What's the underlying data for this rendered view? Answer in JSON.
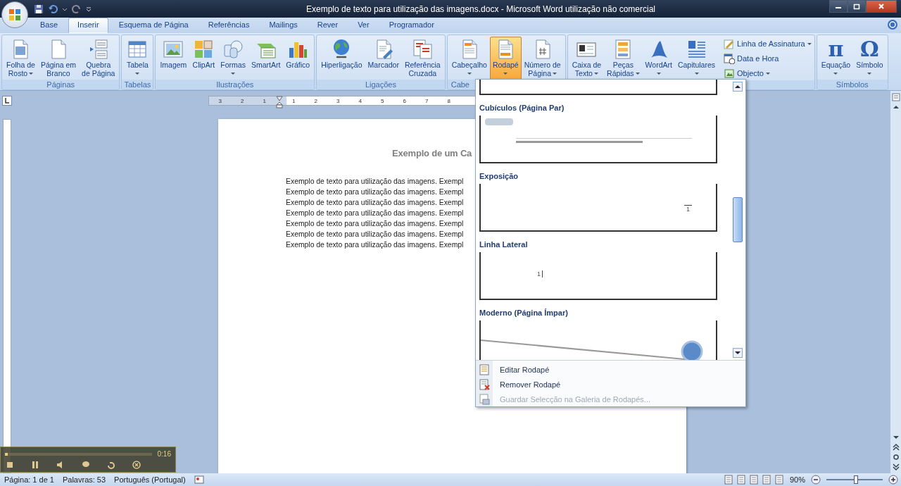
{
  "title_bar": {
    "title": "Exemplo de texto para utilização das imagens.docx - Microsoft Word utilização não comercial"
  },
  "tabs": [
    {
      "label": "Base",
      "selected": false
    },
    {
      "label": "Inserir",
      "selected": true
    },
    {
      "label": "Esquema de Página",
      "selected": false
    },
    {
      "label": "Referências",
      "selected": false
    },
    {
      "label": "Mailings",
      "selected": false
    },
    {
      "label": "Rever",
      "selected": false
    },
    {
      "label": "Ver",
      "selected": false
    },
    {
      "label": "Programador",
      "selected": false
    }
  ],
  "ribbon": {
    "groups": [
      {
        "label": "Páginas",
        "buttons": [
          {
            "lines": [
              "Folha de",
              "Rosto"
            ],
            "menu": true,
            "pressed": false
          },
          {
            "lines": [
              "Página em",
              "Branco"
            ],
            "menu": false,
            "pressed": false
          },
          {
            "lines": [
              "Quebra",
              "de Página"
            ],
            "menu": false,
            "pressed": false
          }
        ]
      },
      {
        "label": "Tabelas",
        "buttons": [
          {
            "lines": [
              "Tabela"
            ],
            "menu": true,
            "pressed": false
          }
        ]
      },
      {
        "label": "Ilustrações",
        "buttons": [
          {
            "lines": [
              "Imagem"
            ],
            "menu": false,
            "pressed": false
          },
          {
            "lines": [
              "ClipArt"
            ],
            "menu": false,
            "pressed": false
          },
          {
            "lines": [
              "Formas"
            ],
            "menu": true,
            "pressed": false
          },
          {
            "lines": [
              "SmartArt"
            ],
            "menu": false,
            "pressed": false
          },
          {
            "lines": [
              "Gráfico"
            ],
            "menu": false,
            "pressed": false
          }
        ]
      },
      {
        "label": "Ligações",
        "buttons": [
          {
            "lines": [
              "Hiperligação"
            ],
            "menu": false,
            "pressed": false
          },
          {
            "lines": [
              "Marcador"
            ],
            "menu": false,
            "pressed": false
          },
          {
            "lines": [
              "Referência",
              "Cruzada"
            ],
            "menu": false,
            "pressed": false
          }
        ]
      },
      {
        "label": "Cabe",
        "label_cut": true,
        "buttons": [
          {
            "lines": [
              "Cabeçalho"
            ],
            "menu": true,
            "pressed": false
          },
          {
            "lines": [
              "Rodapé"
            ],
            "menu": true,
            "pressed": true
          },
          {
            "lines": [
              "Número de",
              "Página"
            ],
            "menu": true,
            "pressed": false
          }
        ]
      },
      {
        "buttons": [
          {
            "lines": [
              "Caixa de",
              "Texto"
            ],
            "menu": true,
            "pressed": false
          },
          {
            "lines": [
              "Peças",
              "Rápidas"
            ],
            "menu": true,
            "pressed": false
          },
          {
            "lines": [
              "WordArt"
            ],
            "menu": true,
            "pressed": false
          },
          {
            "lines": [
              "Capitulares"
            ],
            "menu": true,
            "pressed": false
          }
        ],
        "small": [
          {
            "label": "Linha de Assinatura",
            "menu": true
          },
          {
            "label": "Data e Hora",
            "menu": false
          },
          {
            "label": "Objecto",
            "menu": true
          }
        ]
      },
      {
        "label": "Símbolos",
        "buttons": [
          {
            "lines": [
              "Equação"
            ],
            "menu": true,
            "pressed": false,
            "glyph": "π"
          },
          {
            "lines": [
              "Símbolo"
            ],
            "menu": true,
            "pressed": false,
            "glyph": "Ω"
          }
        ]
      }
    ]
  },
  "ruler": {
    "left_labels": [
      "3",
      "2",
      "1"
    ],
    "right_labels": [
      "1",
      "2",
      "3",
      "4",
      "5",
      "6",
      "7",
      "8"
    ]
  },
  "document": {
    "heading": "Exemplo de um Ca",
    "lines": [
      "Exemplo de texto para utilização das imagens. Exempl",
      "Exemplo de texto para utilização das imagens. Exempl",
      "Exemplo de texto para utilização das imagens. Exempl",
      "Exemplo de texto para utilização das imagens. Exempl",
      "Exemplo de texto para utilização das imagens. Exempl",
      "Exemplo de texto para utilização das imagens. Exempl",
      "Exemplo de texto para utilização das imagens. Exempl"
    ]
  },
  "footer_menu": {
    "gallery": [
      {
        "kind": "cut"
      },
      {
        "kind": "cubicles",
        "title": "Cubículos (Página Par)"
      },
      {
        "kind": "exposure",
        "title": "Exposição",
        "number": "1"
      },
      {
        "kind": "side-line",
        "title": "Linha Lateral",
        "number": "1"
      },
      {
        "kind": "modern",
        "title": "Moderno (Página Ímpar)"
      }
    ],
    "commands": [
      {
        "label": "Editar Rodapé",
        "disabled": false
      },
      {
        "label": "Remover Rodapé",
        "disabled": false
      },
      {
        "label": "Guardar Selecção na Galeria de Rodapés...",
        "disabled": true
      }
    ]
  },
  "player": {
    "level": 0.02,
    "time": "0:16"
  },
  "status_bar": {
    "items": [
      "Página: 1 de 1",
      "Palavras: 53",
      "Português (Portugal)"
    ],
    "zoom": {
      "reading": "90%",
      "level": 0.52
    }
  }
}
